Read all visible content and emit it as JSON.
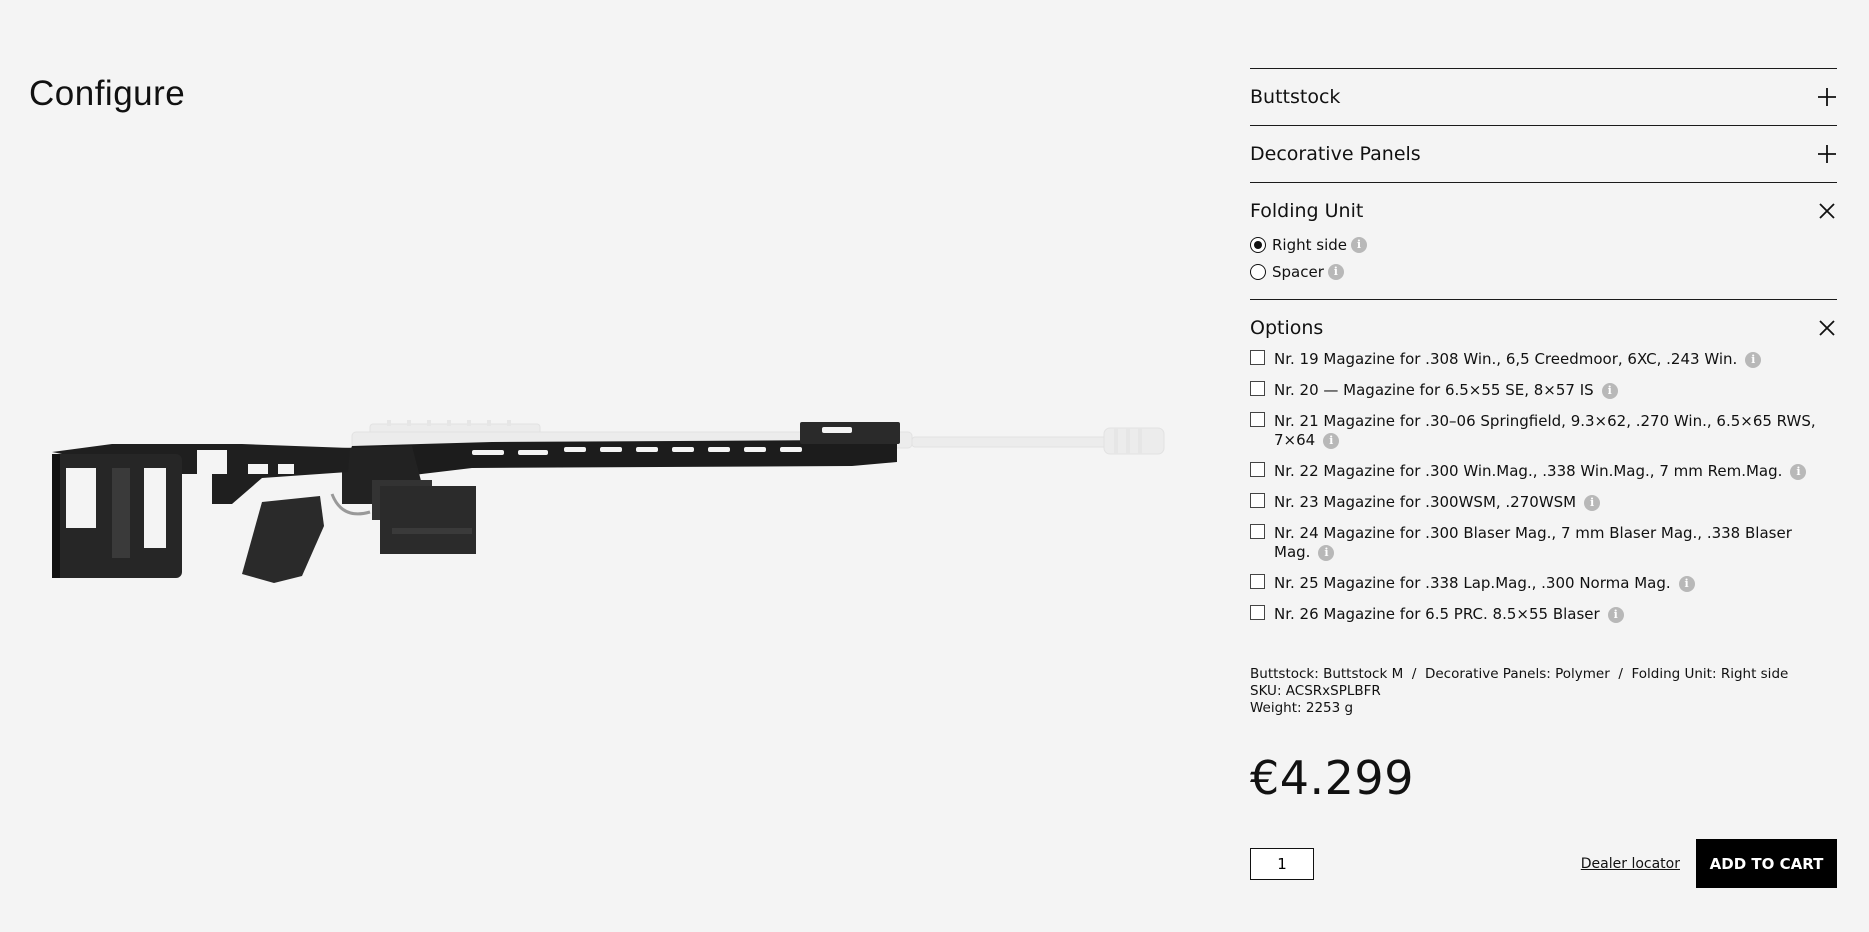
{
  "page": {
    "title": "Configure"
  },
  "configurator": {
    "sections": [
      {
        "title": "Buttstock",
        "state": "collapsed"
      },
      {
        "title": "Decorative Panels",
        "state": "collapsed"
      },
      {
        "title": "Folding Unit",
        "state": "expanded",
        "radios": [
          {
            "label": "Right side",
            "selected": true
          },
          {
            "label": "Spacer",
            "selected": false
          }
        ]
      },
      {
        "title": "Options",
        "state": "expanded",
        "checkboxes": [
          {
            "label": "Nr. 19 Magazine for .308 Win., 6,5 Creedmoor, 6XC, .243 Win.",
            "checked": false
          },
          {
            "label": "Nr. 20 — Magazine for 6.5×55 SE, 8×57 IS",
            "checked": false
          },
          {
            "label": "Nr. 21 Magazine for .30–06 Springfield, 9.3×62, .270 Win., 6.5×65 RWS, 7×64",
            "checked": false
          },
          {
            "label": "Nr. 22 Magazine for .300 Win.Mag., .338 Win.Mag., 7 mm Rem.Mag.",
            "checked": false
          },
          {
            "label": "Nr. 23 Magazine for .300WSM, .270WSM",
            "checked": false
          },
          {
            "label": "Nr. 24 Magazine for .300 Blaser Mag., 7 mm Blaser Mag., .338 Blaser Mag.",
            "checked": false
          },
          {
            "label": "Nr. 25 Magazine for .338 Lap.Mag., .300 Norma Mag.",
            "checked": false
          },
          {
            "label": "Nr. 26 Magazine for 6.5 PRC. 8.5×55 Blaser",
            "checked": false
          }
        ]
      }
    ],
    "info_glyph": "i"
  },
  "summary": {
    "line1": "Buttstock: Buttstock M  /  Decorative Panels: Polymer  /  Folding Unit: Right side",
    "sku": "SKU: ACSRxSPLBFR",
    "weight": "Weight: 2253 g"
  },
  "price": "€4.299",
  "quantity": "1",
  "dealer_link": "Dealer locator",
  "cart_button": "ADD TO CART",
  "icons": {
    "collapsed": "plus-icon",
    "expanded": "close-icon",
    "info": "info-icon"
  },
  "colors": {
    "background": "#f4f4f4",
    "button": "#000000",
    "info_badge": "#b8b8b8"
  }
}
